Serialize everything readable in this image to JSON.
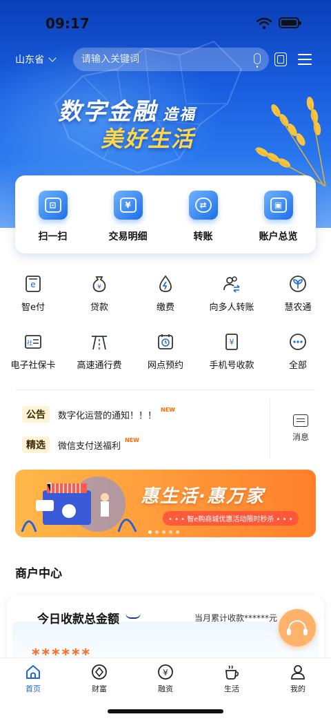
{
  "status_bar": {
    "time": "09:17"
  },
  "header": {
    "region": "山东省",
    "search_placeholder": "请输入关键词"
  },
  "hero": {
    "slogan_line1": "数字金融",
    "slogan_line1_small": "造福",
    "slogan_line2": "美好生活"
  },
  "quick_actions": [
    {
      "label": "扫一扫",
      "icon": "scan-icon"
    },
    {
      "label": "交易明细",
      "icon": "transaction-detail-icon"
    },
    {
      "label": "转账",
      "icon": "transfer-icon"
    },
    {
      "label": "账户总览",
      "icon": "account-overview-icon"
    }
  ],
  "services": [
    {
      "label": "智e付",
      "icon": "e-pay-icon"
    },
    {
      "label": "贷款",
      "icon": "loan-icon"
    },
    {
      "label": "缴费",
      "icon": "payment-icon"
    },
    {
      "label": "向多人转账",
      "icon": "multi-transfer-icon"
    },
    {
      "label": "慧农通",
      "icon": "agriculture-icon"
    },
    {
      "label": "电子社保卡",
      "icon": "social-security-card-icon"
    },
    {
      "label": "高速通行费",
      "icon": "highway-toll-icon"
    },
    {
      "label": "网点预约",
      "icon": "branch-appointment-icon"
    },
    {
      "label": "手机号收款",
      "icon": "phone-receive-icon"
    },
    {
      "label": "全部",
      "icon": "more-icon"
    }
  ],
  "notices": [
    {
      "tag": "公告",
      "text": "数字化运营的通知！！！",
      "badge": "NEW"
    },
    {
      "tag": "精选",
      "text": "微信支付送福利",
      "badge": "NEW"
    }
  ],
  "message_label": "消息",
  "banner": {
    "title": "惠生活·惠万家",
    "subtitle": "• • • 智e购商城优惠活动限时秒杀 • • •"
  },
  "merchant": {
    "section_title": "商户中心",
    "today_label": "今日收款总金额",
    "month_label": "当月累计收款******元",
    "amount_masked": "******"
  },
  "tabbar": [
    {
      "label": "首页",
      "active": true
    },
    {
      "label": "财富",
      "active": false
    },
    {
      "label": "融资",
      "active": false
    },
    {
      "label": "生活",
      "active": false
    },
    {
      "label": "我的",
      "active": false
    }
  ],
  "colors": {
    "brand_blue": "#1a66e0",
    "accent_orange": "#ff6a1a",
    "hero_top": "#0a3fb8"
  }
}
